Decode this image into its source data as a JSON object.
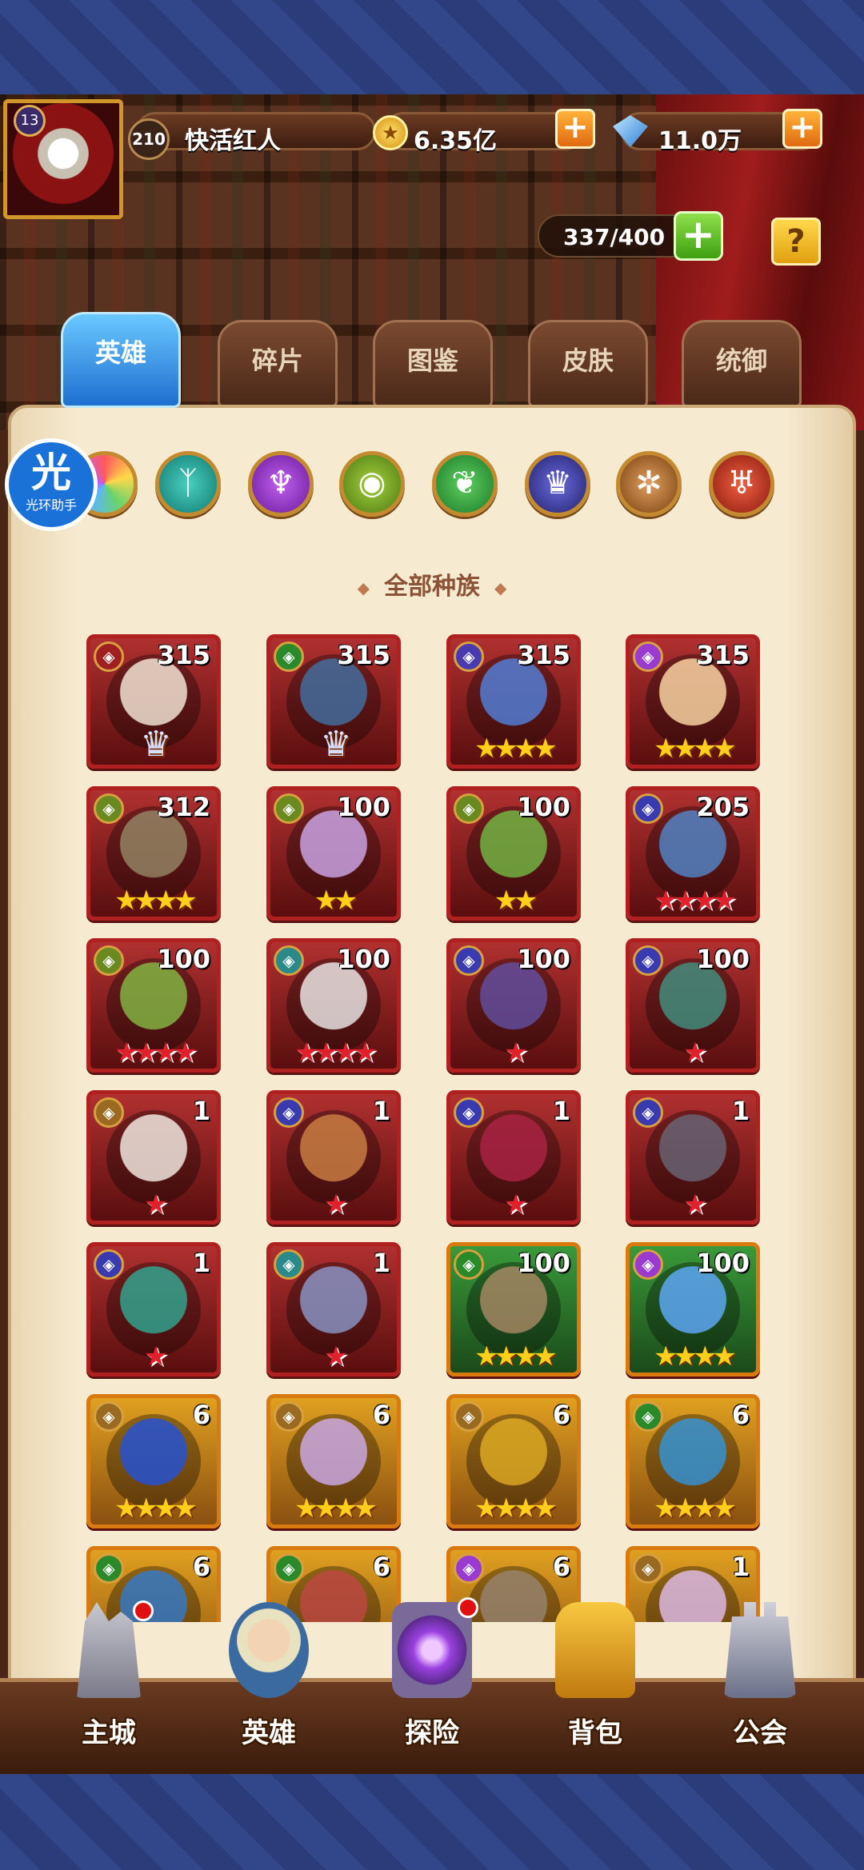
{
  "player": {
    "level": "13",
    "vip": "210",
    "name": "快活红人",
    "gold": "6.35亿",
    "gems": "11.0万"
  },
  "capacity": {
    "text": "337/400"
  },
  "help": {
    "label": "?"
  },
  "tabs": [
    {
      "label": "英雄"
    },
    {
      "label": "碎片"
    },
    {
      "label": "图鉴"
    },
    {
      "label": "皮肤"
    },
    {
      "label": "统御"
    }
  ],
  "badge": {
    "big": "光",
    "small": "光环助手"
  },
  "race_filter": {
    "title": "全部种族"
  },
  "heroes": [
    {
      "lvl": "315",
      "star_kind": "crown",
      "stars": 2
    },
    {
      "lvl": "315",
      "star_kind": "crown",
      "stars": 2
    },
    {
      "lvl": "315",
      "star_kind": "gold",
      "stars": 4
    },
    {
      "lvl": "315",
      "star_kind": "gold",
      "stars": 4
    },
    {
      "lvl": "312",
      "star_kind": "gold",
      "stars": 4
    },
    {
      "lvl": "100",
      "star_kind": "gold",
      "stars": 2
    },
    {
      "lvl": "100",
      "star_kind": "gold",
      "stars": 2
    },
    {
      "lvl": "205",
      "star_kind": "red",
      "stars": 4
    },
    {
      "lvl": "100",
      "star_kind": "red",
      "stars": 4
    },
    {
      "lvl": "100",
      "star_kind": "red",
      "stars": 4
    },
    {
      "lvl": "100",
      "star_kind": "red",
      "stars": 1
    },
    {
      "lvl": "100",
      "star_kind": "red",
      "stars": 1
    },
    {
      "lvl": "1",
      "star_kind": "red",
      "stars": 1
    },
    {
      "lvl": "1",
      "star_kind": "red",
      "stars": 1
    },
    {
      "lvl": "1",
      "star_kind": "red",
      "stars": 1
    },
    {
      "lvl": "1",
      "star_kind": "red",
      "stars": 1
    },
    {
      "lvl": "1",
      "star_kind": "red",
      "stars": 1
    },
    {
      "lvl": "1",
      "star_kind": "red",
      "stars": 1
    },
    {
      "lvl": "100",
      "star_kind": "gold",
      "stars": 4
    },
    {
      "lvl": "100",
      "star_kind": "gold",
      "stars": 4
    },
    {
      "lvl": "6",
      "star_kind": "gold",
      "stars": 4
    },
    {
      "lvl": "6",
      "star_kind": "gold",
      "stars": 4
    },
    {
      "lvl": "6",
      "star_kind": "gold",
      "stars": 4
    },
    {
      "lvl": "6",
      "star_kind": "gold",
      "stars": 4
    },
    {
      "lvl": "6",
      "star_kind": "gold",
      "stars": 0
    },
    {
      "lvl": "6",
      "star_kind": "gold",
      "stars": 0
    },
    {
      "lvl": "6",
      "star_kind": "gold",
      "stars": 0
    },
    {
      "lvl": "1",
      "star_kind": "gold",
      "stars": 0
    }
  ],
  "nav": [
    {
      "label": "主城"
    },
    {
      "label": "英雄"
    },
    {
      "label": "探险"
    },
    {
      "label": "背包"
    },
    {
      "label": "公会"
    }
  ]
}
